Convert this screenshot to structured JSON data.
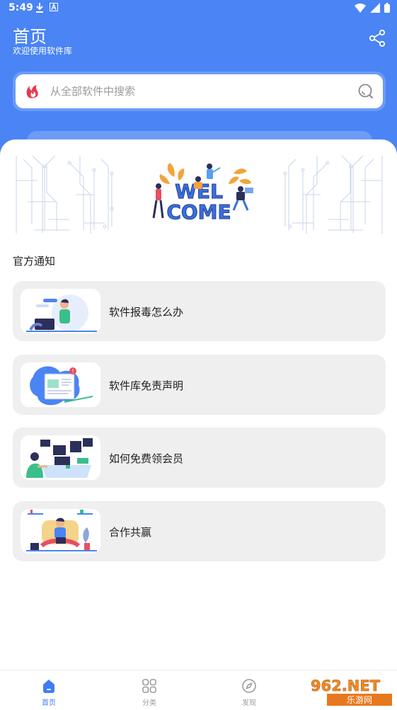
{
  "status": {
    "time": "5:49"
  },
  "header": {
    "title": "首页",
    "subtitle": "欢迎使用软件库"
  },
  "search": {
    "placeholder": "从全部软件中搜索"
  },
  "banner": {
    "text_line1": "WEL",
    "text_line2": "COME"
  },
  "notices": {
    "title": "官方通知",
    "items": [
      {
        "label": "软件报毒怎么办"
      },
      {
        "label": "软件库免责声明"
      },
      {
        "label": "如何免费领会员"
      },
      {
        "label": "合作共赢"
      }
    ]
  },
  "tabs": [
    {
      "label": "首页",
      "icon": "home-icon",
      "active": true
    },
    {
      "label": "分类",
      "icon": "category-icon",
      "active": false
    },
    {
      "label": "发现",
      "icon": "compass-icon",
      "active": false
    }
  ],
  "watermark": {
    "text_top": "962.NET",
    "text_bottom": "乐游网"
  },
  "colors": {
    "primary": "#4a84f5",
    "card_bg": "#efefef",
    "tab_active": "#3f7df2",
    "tab_inactive": "#9b9b9b"
  }
}
